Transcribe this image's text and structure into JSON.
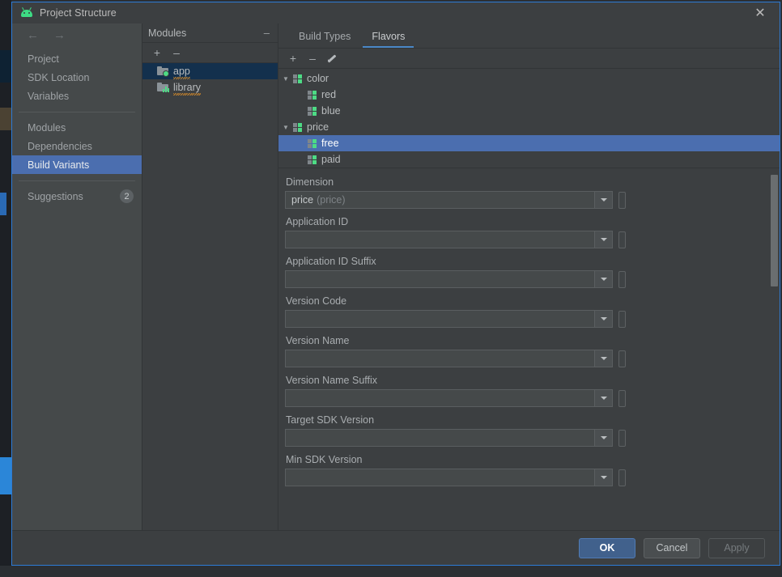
{
  "window": {
    "title": "Project Structure",
    "app_icon": "android-robot-icon",
    "close_label": "✕"
  },
  "nav": {
    "back_arrow": "←",
    "forward_arrow": "→",
    "groups": [
      {
        "items": [
          {
            "label": "Project",
            "selected": false
          },
          {
            "label": "SDK Location",
            "selected": false
          },
          {
            "label": "Variables",
            "selected": false
          }
        ]
      },
      {
        "items": [
          {
            "label": "Modules",
            "selected": false
          },
          {
            "label": "Dependencies",
            "selected": false
          },
          {
            "label": "Build Variants",
            "selected": true
          }
        ]
      },
      {
        "items": [
          {
            "label": "Suggestions",
            "selected": false,
            "badge": "2"
          }
        ]
      }
    ]
  },
  "modules": {
    "title": "Modules",
    "collapse_label": "–",
    "toolbar": {
      "add_label": "+",
      "remove_label": "–"
    },
    "items": [
      {
        "label": "app",
        "icon": "folder-green-dot-icon",
        "selected": true
      },
      {
        "label": "library",
        "icon": "folder-bar-chart-icon",
        "selected": false
      }
    ]
  },
  "pane": {
    "tabs": [
      {
        "label": "Build Types",
        "active": false
      },
      {
        "label": "Flavors",
        "active": true
      }
    ],
    "toolbar": {
      "add_label": "+",
      "remove_label": "–",
      "edit_label": "edit-pencil-icon"
    },
    "tree": [
      {
        "label": "color",
        "level": 0,
        "expanded": true,
        "selected": false
      },
      {
        "label": "red",
        "level": 1,
        "expanded": null,
        "selected": false
      },
      {
        "label": "blue",
        "level": 1,
        "expanded": null,
        "selected": false
      },
      {
        "label": "price",
        "level": 0,
        "expanded": true,
        "selected": false
      },
      {
        "label": "free",
        "level": 1,
        "expanded": null,
        "selected": true
      },
      {
        "label": "paid",
        "level": 1,
        "expanded": null,
        "selected": false
      }
    ],
    "expand_glyph": "▼",
    "fields": [
      {
        "label": "Dimension",
        "value": "price",
        "hint": "(price)"
      },
      {
        "label": "Application ID",
        "value": "",
        "hint": ""
      },
      {
        "label": "Application ID Suffix",
        "value": "",
        "hint": ""
      },
      {
        "label": "Version Code",
        "value": "",
        "hint": ""
      },
      {
        "label": "Version Name",
        "value": "",
        "hint": ""
      },
      {
        "label": "Version Name Suffix",
        "value": "",
        "hint": ""
      },
      {
        "label": "Target SDK Version",
        "value": "",
        "hint": ""
      },
      {
        "label": "Min SDK Version",
        "value": "",
        "hint": ""
      }
    ]
  },
  "footer": {
    "ok_label": "OK",
    "cancel_label": "Cancel",
    "apply_label": "Apply"
  },
  "colors": {
    "accent_blue": "#4b6eaf",
    "tab_underline": "#4a88c7",
    "window_border": "#2d7bd6",
    "flavor_green": "#4ddb85",
    "panel_bg": "#3c3f41",
    "nav_bg": "#45494a"
  }
}
